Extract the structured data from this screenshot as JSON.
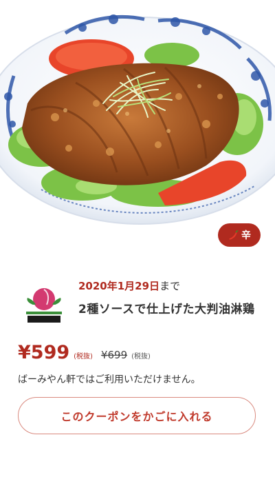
{
  "hero": {
    "image": "fried-chicken-youlinji-dish",
    "close_icon": "close-icon"
  },
  "badge": {
    "icon": "chili-pepper-icon",
    "label": "辛",
    "color": "#b02a1f"
  },
  "coupon": {
    "logo": "bamiyan-logo",
    "expiry_date": "2020年1月29日",
    "expiry_suffix": "まで",
    "title": "2種ソースで仕上げた大判油淋鶏",
    "price": "¥599",
    "price_tax_note": "(税抜)",
    "original_price": "¥699",
    "original_tax_note": "(税抜)",
    "notice": "ばーみやん軒ではご利用いただけません。",
    "cta_label": "このクーポンをかごに入れる"
  },
  "colors": {
    "accent": "#b02a1f",
    "cta_border": "#d9897e",
    "text": "#333333"
  }
}
